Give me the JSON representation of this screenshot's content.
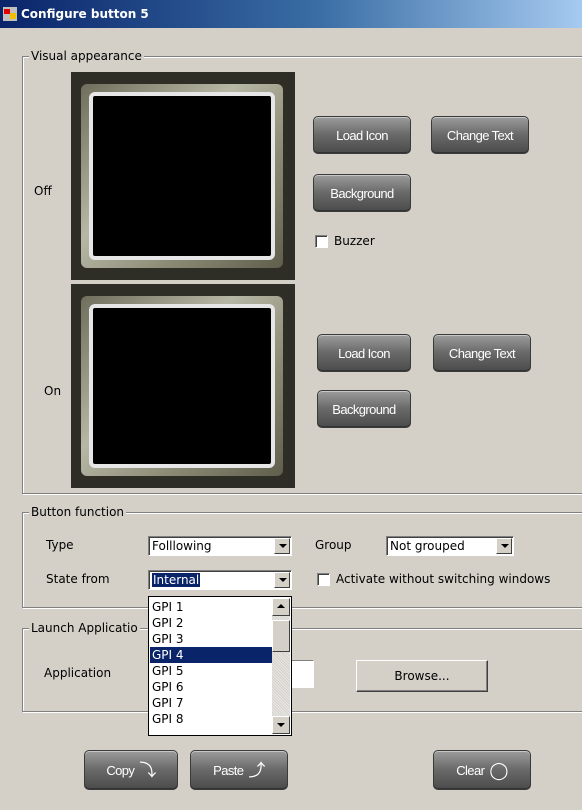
{
  "window": {
    "title": "Configure button 5",
    "app_icon": "app-logo-icon"
  },
  "visual_appearance": {
    "legend": "Visual appearance",
    "off": {
      "label": "Off",
      "load_icon": "Load Icon",
      "change_text": "Change Text",
      "background": "Background",
      "buzzer_label": "Buzzer",
      "buzzer_checked": false
    },
    "on": {
      "label": "On",
      "load_icon": "Load Icon",
      "change_text": "Change Text",
      "background": "Background"
    }
  },
  "button_function": {
    "legend": "Button function",
    "type_label": "Type",
    "type_value": "Folllowing",
    "group_label": "Group",
    "group_value": "Not grouped",
    "state_label": "State from",
    "state_value": "Internal",
    "activate_label": "Activate without switching windows",
    "activate_checked": false
  },
  "state_dropdown": {
    "options": [
      "GPI 1",
      "GPI 2",
      "GPI 3",
      "GPI 4",
      "GPI 5",
      "GPI 6",
      "GPI 7",
      "GPI 8"
    ],
    "selected": "GPI 4"
  },
  "launch_application": {
    "legend": "Launch Applicatio",
    "app_label": "Application",
    "app_value": "",
    "browse_label": "Browse..."
  },
  "footer": {
    "copy_label": "Copy",
    "copy_icon": "copy-arrow-icon",
    "paste_label": "Paste",
    "paste_icon": "paste-arrow-icon",
    "clear_label": "Clear",
    "clear_icon": "circle-icon"
  }
}
